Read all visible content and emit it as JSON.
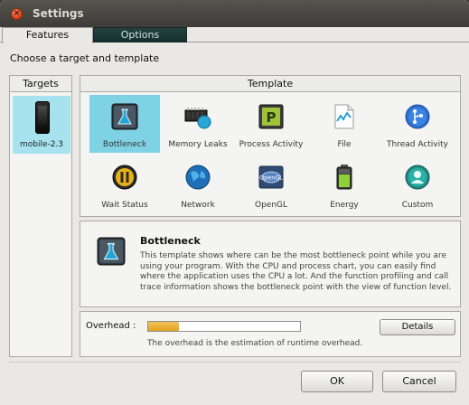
{
  "window": {
    "title": "Settings"
  },
  "tabs": [
    {
      "label": "Features",
      "selected": true
    },
    {
      "label": "Options",
      "selected": false
    }
  ],
  "subtitle": "Choose a target and template",
  "targets": {
    "header": "Targets",
    "items": [
      {
        "label": "mobile-2.3",
        "icon": "phone-icon",
        "selected": true
      }
    ]
  },
  "templates": {
    "header": "Template",
    "items": [
      {
        "label": "Bottleneck",
        "icon": "flask-icon",
        "selected": true
      },
      {
        "label": "Memory Leaks",
        "icon": "memory-chip-icon",
        "selected": false
      },
      {
        "label": "Process Activity",
        "icon": "process-p-icon",
        "selected": false
      },
      {
        "label": "File",
        "icon": "file-icon",
        "selected": false
      },
      {
        "label": "Thread Activity",
        "icon": "thread-icon",
        "selected": false
      },
      {
        "label": "Wait Status",
        "icon": "pause-icon",
        "selected": false
      },
      {
        "label": "Network",
        "icon": "globe-icon",
        "selected": false
      },
      {
        "label": "OpenGL",
        "icon": "opengl-icon",
        "selected": false
      },
      {
        "label": "Energy",
        "icon": "battery-icon",
        "selected": false
      },
      {
        "label": "Custom",
        "icon": "user-icon",
        "selected": false
      }
    ]
  },
  "detail": {
    "title": "Bottleneck",
    "description": "This template shows where can be the most bottleneck point while you are using your program. With the CPU and process chart, you can easily find where the application uses the CPU a lot. And the function profiling and call trace information shows the bottleneck point with the view of function level."
  },
  "overhead": {
    "label": "Overhead :",
    "level": 0.2,
    "note": "The overhead is the estimation of runtime overhead.",
    "details_label": "Details"
  },
  "buttons": {
    "ok": "OK",
    "cancel": "Cancel"
  },
  "colors": {
    "selection": "#7fd2e4",
    "target_selection": "#a6e3ee",
    "overhead_fill": "#e8ab25",
    "tab_inactive": "#1c3937"
  }
}
